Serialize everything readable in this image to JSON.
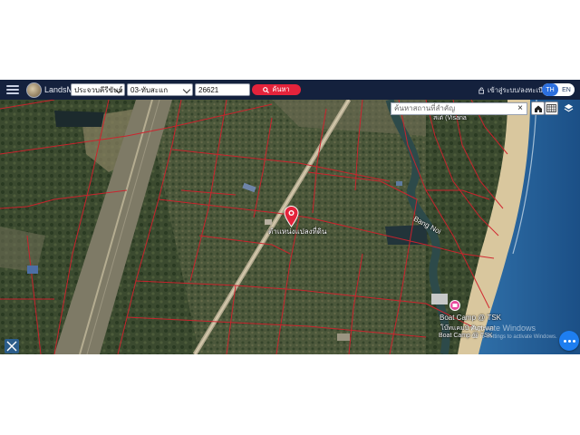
{
  "header": {
    "brand": "LandsMaps",
    "province": "ประจวบคีรีขันธ์",
    "district": "03-ทับสะแก",
    "parcel_number": "26621",
    "search_label": "ค้นหา",
    "login_label": "เข้าสู่ระบบ/ลงทะเบียน",
    "lang_th": "TH",
    "lang_en": "EN",
    "accent_color": "#e4233b",
    "bar_color": "#14213d"
  },
  "map": {
    "place_search_placeholder": "ค้นหาสถานที่สำคัญ",
    "clear_symbol": "×",
    "parcel_label": "ตำแหน่งแปลงที่ดิน",
    "labels": {
      "visana": "สเต์ (Visana",
      "bang_noi": "Bang Noi",
      "boat_camp": "Boat Camp @ TSK",
      "boat_camp_sub": "Boat Camp @ TSK",
      "boat_camp_thai": "โบ๊ทแคมป์ ทับสะแก"
    },
    "icons": [
      "home-icon",
      "grid-icon",
      "layers-icon",
      "ruler-tool-icon",
      "more-icon",
      "location-pin-icon"
    ]
  },
  "watermark": {
    "title": "Activate Windows",
    "subtitle": "Go to Settings to activate Windows."
  }
}
